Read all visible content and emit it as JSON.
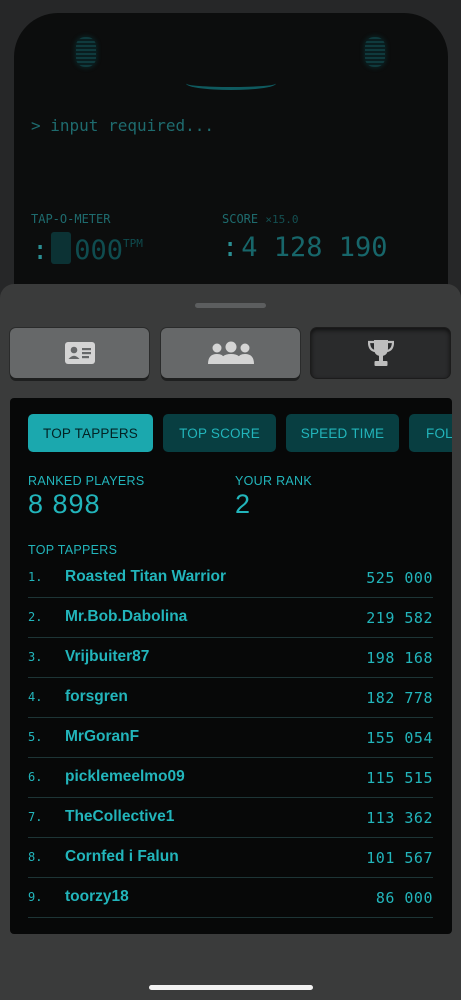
{
  "device": {
    "prompt": "> input required...",
    "tap_meter": {
      "label": "TAP-O-METER",
      "value": "000",
      "unit": "TPM"
    },
    "score": {
      "label": "SCORE",
      "multiplier": "×15.0",
      "value": "4 128 190"
    }
  },
  "segments": [
    {
      "icon": "id-card-icon"
    },
    {
      "icon": "community-icon"
    },
    {
      "icon": "trophy-icon",
      "active": true
    }
  ],
  "leaderboard": {
    "tabs": [
      {
        "label": "TOP TAPPERS",
        "active": true
      },
      {
        "label": "TOP SCORE"
      },
      {
        "label": "SPEED TIME"
      },
      {
        "label": "FOL"
      }
    ],
    "ranked_players_label": "RANKED PLAYERS",
    "ranked_players_value": "8 898",
    "your_rank_label": "YOUR RANK",
    "your_rank_value": "2",
    "list_title": "TOP TAPPERS",
    "rows": [
      {
        "rank": "1.",
        "name": "Roasted Titan Warrior",
        "score": "525 000"
      },
      {
        "rank": "2.",
        "name": "Mr.Bob.Dabolina",
        "score": "219 582"
      },
      {
        "rank": "3.",
        "name": "Vrijbuiter87",
        "score": "198 168"
      },
      {
        "rank": "4.",
        "name": "forsgren",
        "score": "182 778"
      },
      {
        "rank": "5.",
        "name": "MrGoranF",
        "score": "155 054"
      },
      {
        "rank": "6.",
        "name": "picklemeelmo09",
        "score": "115 515"
      },
      {
        "rank": "7.",
        "name": "TheCollective1",
        "score": "113 362"
      },
      {
        "rank": "8.",
        "name": "Cornfed i Falun",
        "score": "101 567"
      },
      {
        "rank": "9.",
        "name": "toorzy18",
        "score": "86 000"
      }
    ]
  },
  "colors": {
    "accent": "#1ba8ae",
    "accent_text": "#22b5bb",
    "panel_bg": "#070808",
    "sheet_bg": "#3a3b3b"
  }
}
